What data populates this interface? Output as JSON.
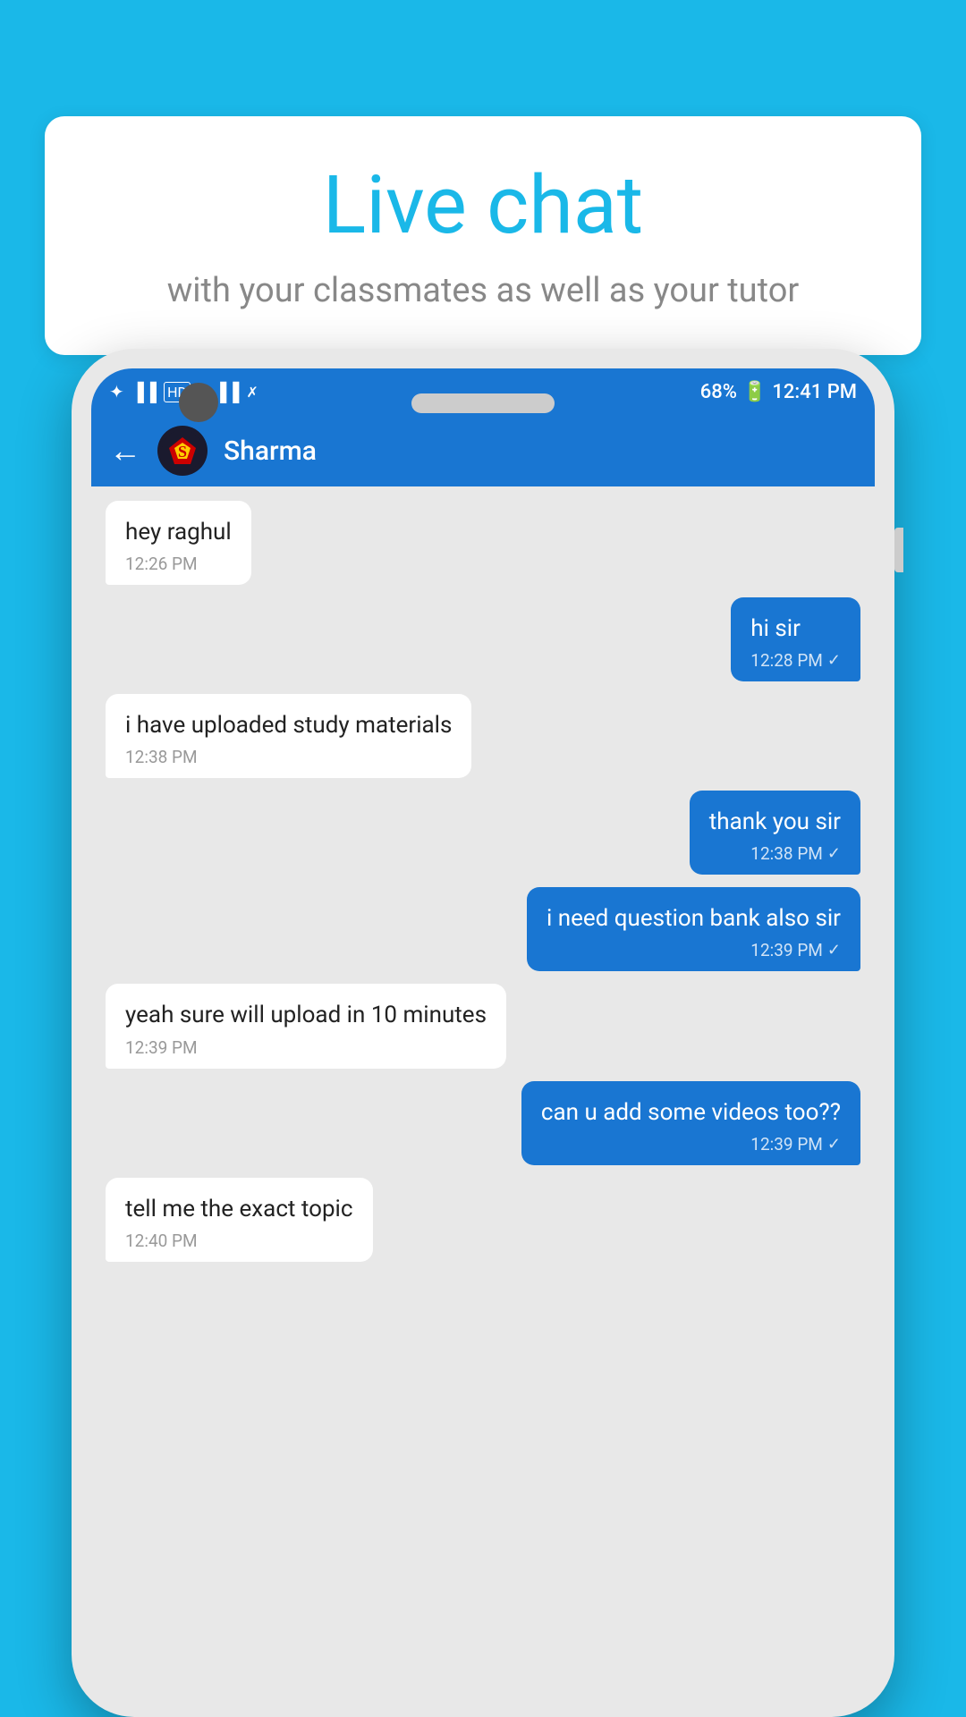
{
  "background_color": "#1ab8e8",
  "speech_bubble": {
    "title": "Live chat",
    "subtitle": "with your classmates as well as your tutor"
  },
  "status_bar": {
    "time": "12:41 PM",
    "battery": "68%",
    "signal_icons": "🔵 📶 📶"
  },
  "chat_header": {
    "contact_name": "Sharma",
    "back_label": "←"
  },
  "messages": [
    {
      "id": 1,
      "direction": "incoming",
      "text": "hey raghul",
      "time": "12:26 PM"
    },
    {
      "id": 2,
      "direction": "outgoing",
      "text": "hi sir",
      "time": "12:28 PM",
      "checkmark": "✓"
    },
    {
      "id": 3,
      "direction": "incoming",
      "text": "i have uploaded study materials",
      "time": "12:38 PM"
    },
    {
      "id": 4,
      "direction": "outgoing",
      "text": "thank you sir",
      "time": "12:38 PM",
      "checkmark": "✓"
    },
    {
      "id": 5,
      "direction": "outgoing",
      "text": "i need question bank also sir",
      "time": "12:39 PM",
      "checkmark": "✓"
    },
    {
      "id": 6,
      "direction": "incoming",
      "text": "yeah sure will upload in 10 minutes",
      "time": "12:39 PM"
    },
    {
      "id": 7,
      "direction": "outgoing",
      "text": "can u add some videos too??",
      "time": "12:39 PM",
      "checkmark": "✓"
    },
    {
      "id": 8,
      "direction": "incoming",
      "text": "tell me the exact topic",
      "time": "12:40 PM"
    }
  ]
}
